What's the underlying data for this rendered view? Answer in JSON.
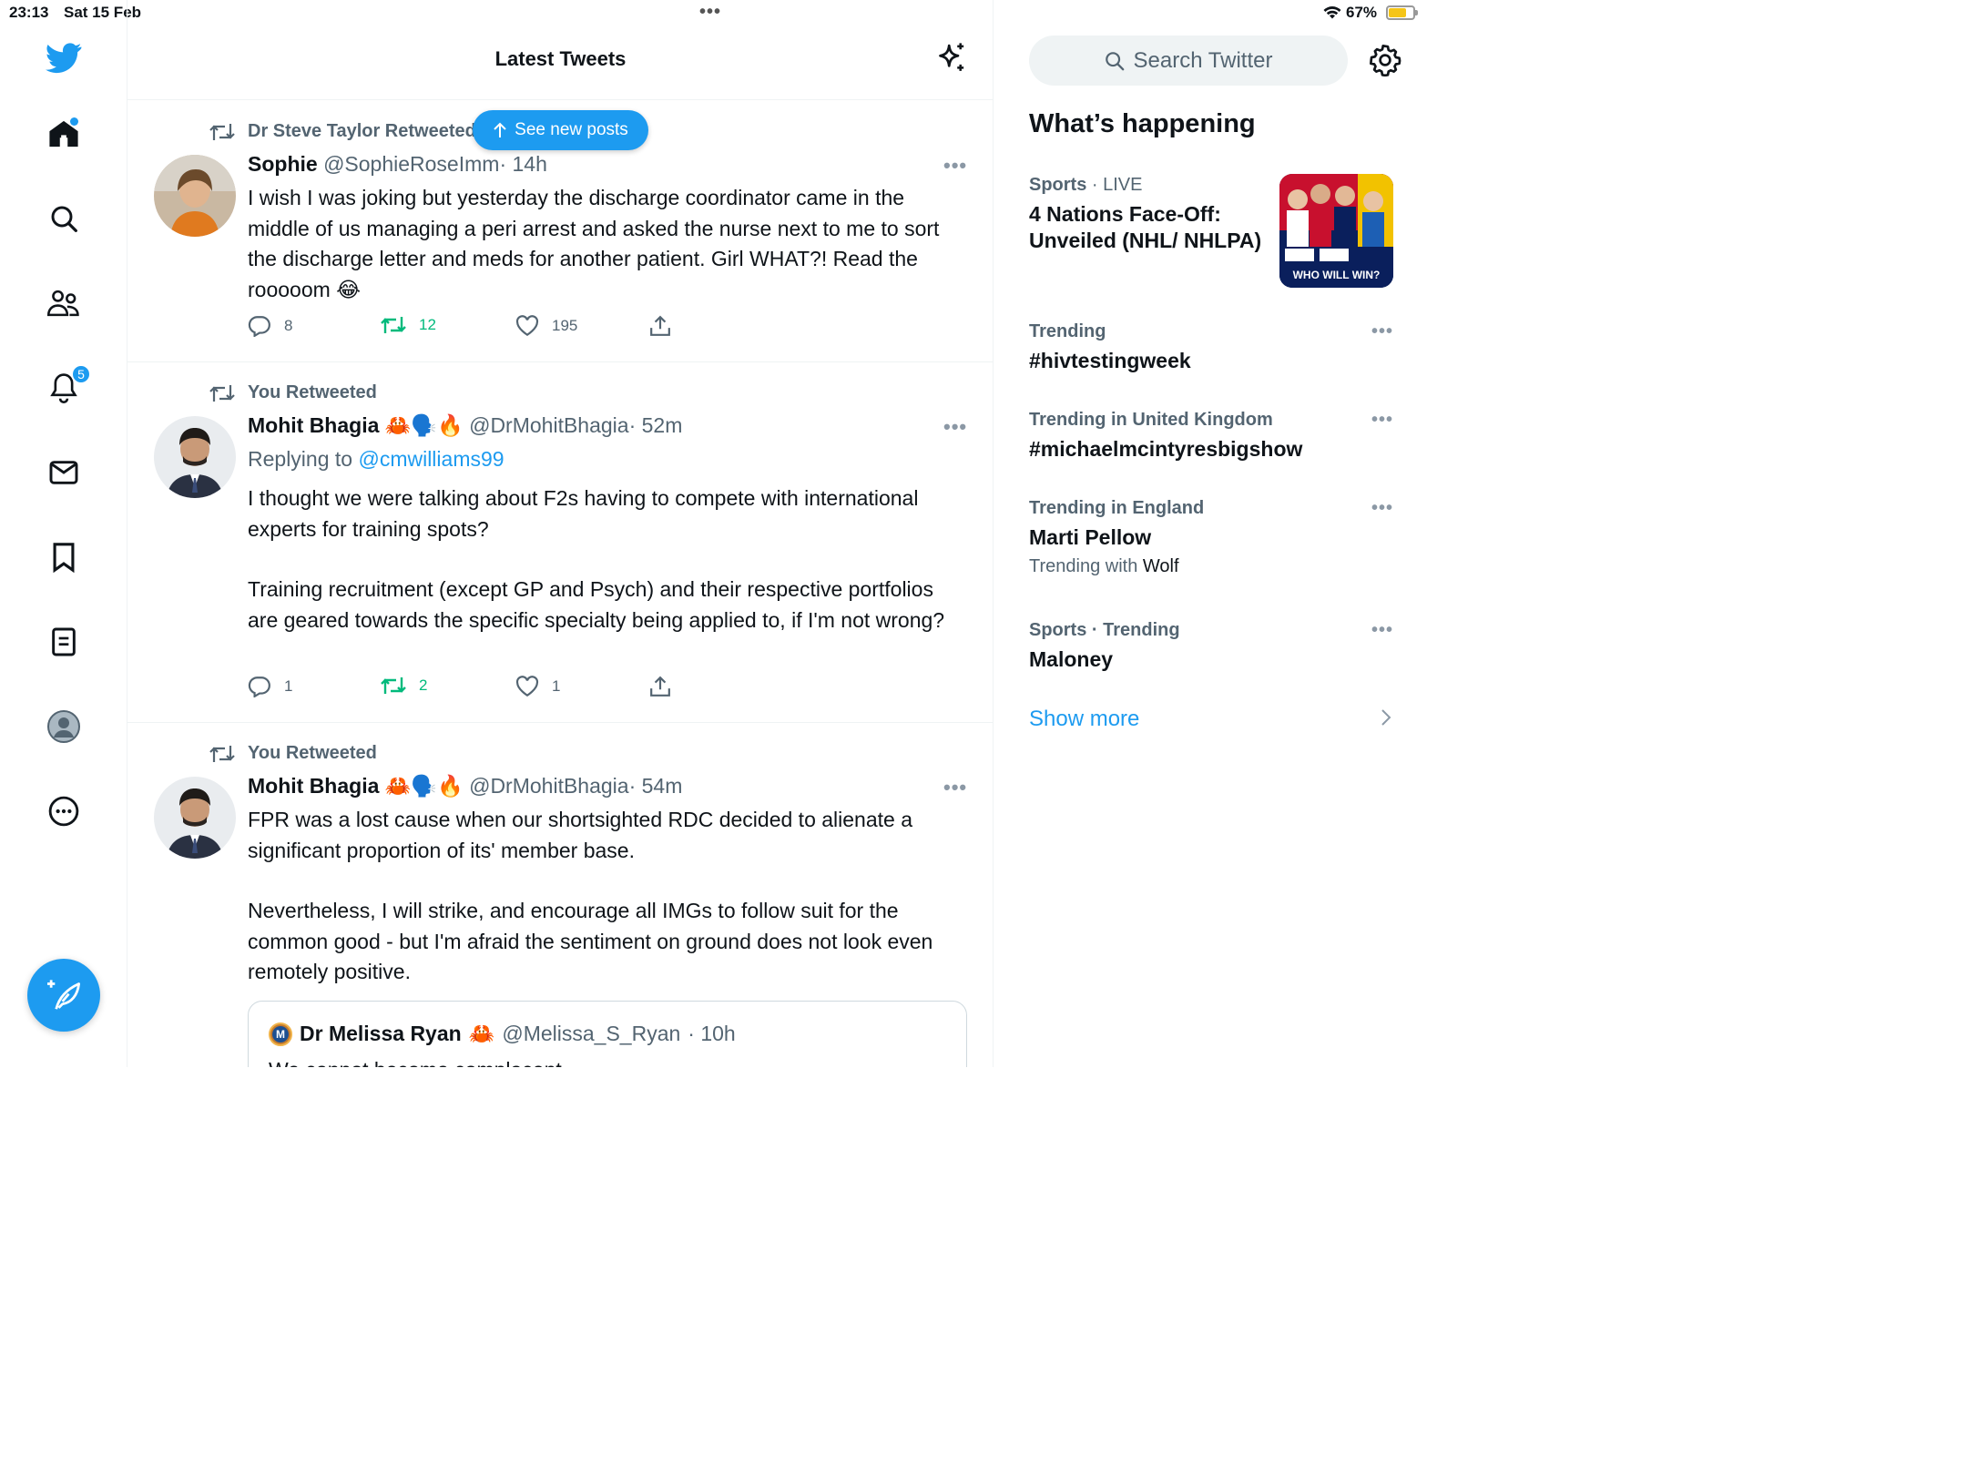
{
  "status_bar": {
    "time": "23:13",
    "date": "Sat 15 Feb",
    "battery": "67%"
  },
  "nav": {
    "notifications_badge": "5",
    "icons": [
      "twitter-logo-icon",
      "home-icon",
      "search-icon",
      "communities-icon",
      "notifications-icon",
      "messages-icon",
      "bookmarks-icon",
      "lists-icon",
      "profile-icon",
      "more-icon",
      "compose-icon"
    ],
    "accent": "#1d9bf0"
  },
  "main": {
    "title": "Latest Tweets",
    "see_new_posts": "See new posts",
    "tweets": [
      {
        "retweeted_by": "Dr Steve Taylor Retweeted",
        "name": "Sophie",
        "handle": "@SophieRoseImm",
        "time": "· 14h",
        "body": [
          "I wish I was joking but yesterday the discharge coordinator came in the middle of us managing a peri arrest and asked the nurse next to me to sort the discharge letter and meds for another patient. Girl WHAT?! Read the rooooom 😂"
        ],
        "replies": "8",
        "retweets": "12",
        "likes": "195"
      },
      {
        "retweeted_by": "You Retweeted",
        "name": "Mohit Bhagia",
        "emoji": "🦀🗣️🔥",
        "handle": "@DrMohitBhagia",
        "time": "· 52m",
        "replying_prefix": "Replying to",
        "replying_to": "@cmwilliams99",
        "body": [
          "I thought we were talking about F2s having to compete with international experts for training spots?",
          "Training recruitment (except GP and Psych) and their respective portfolios are geared towards the specific specialty being applied to, if I'm not wrong?"
        ],
        "replies": "1",
        "retweets": "2",
        "likes": "1"
      },
      {
        "retweeted_by": "You Retweeted",
        "name": "Mohit Bhagia",
        "emoji": "🦀🗣️🔥",
        "handle": "@DrMohitBhagia",
        "time": "· 54m",
        "body": [
          "FPR was a lost cause when our shortsighted RDC decided to alienate a significant proportion of its' member base.",
          "Nevertheless, I will strike, and encourage all IMGs to follow suit for the common good - but I'm afraid the sentiment on ground does not look even remotely positive."
        ],
        "quote": {
          "avatar_letter": "M",
          "name": "Dr Melissa Ryan",
          "emoji": "🦀",
          "handle": "@Melissa_S_Ryan",
          "time": "· 10h",
          "body": "We cannot become complacent"
        }
      }
    ]
  },
  "right": {
    "search_placeholder": "Search Twitter",
    "whats_happening": "What’s happening",
    "news": {
      "context": "Sports",
      "live": "· LIVE",
      "headline": "4 Nations Face-Off: Unveiled (NHL/ NHLPA)",
      "image_text": "WHO WILL WIN?"
    },
    "trends": [
      {
        "context": "Trending",
        "name": "#hivtestingweek"
      },
      {
        "context": "Trending in United Kingdom",
        "name": "#michaelmcintyresbigshow"
      },
      {
        "context": "Trending in England",
        "name": "Marti Pellow",
        "with_prefix": "Trending with",
        "with": "Wolf"
      },
      {
        "context": "Sports · Trending",
        "name": "Maloney"
      }
    ],
    "show_more": "Show more"
  }
}
